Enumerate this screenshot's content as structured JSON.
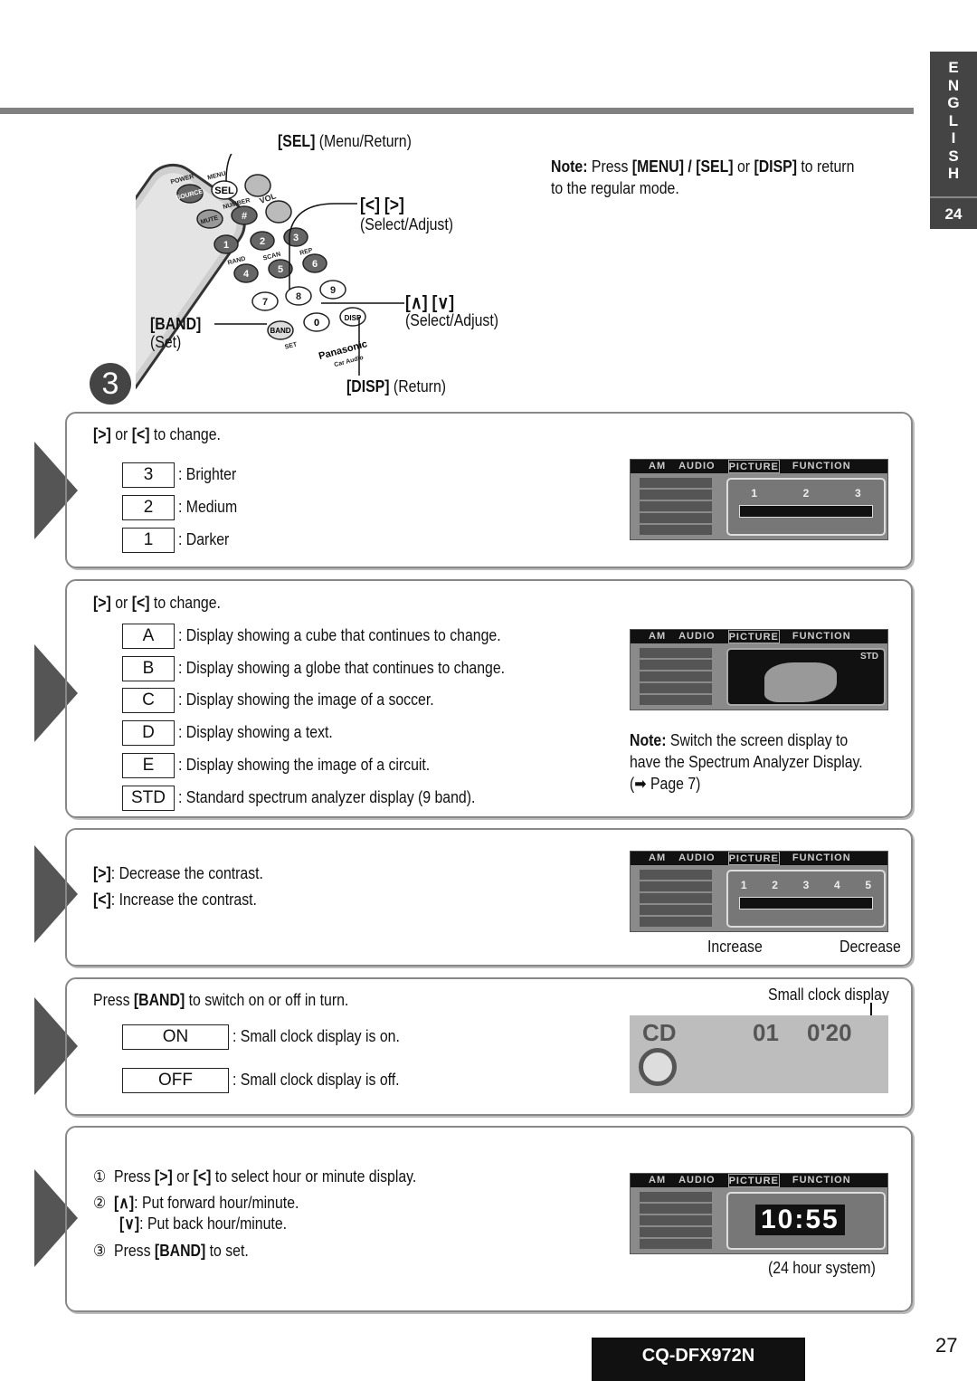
{
  "lang_tab": {
    "letters": "E N G L I S H",
    "page": "24"
  },
  "remote": {
    "sel": "[SEL]",
    "sel_desc": "(Menu/Return)",
    "lr": "[<] [>]",
    "lr_desc": "(Select/Adjust)",
    "ud": "[∧] [∨]",
    "ud_desc": "(Select/Adjust)",
    "band": "[BAND]",
    "band_desc": "(Set)",
    "disp": "[DISP]",
    "disp_desc": "(Return)",
    "brand": "Panasonic",
    "brand_sub": "Car Audio",
    "buttons": [
      "POWER",
      "SOURCE",
      "MENU",
      "SEL",
      "NUMBER",
      "VOL",
      "MUTE",
      "#",
      "1",
      "2",
      "3",
      "RAND",
      "SCAN",
      "REP",
      "4",
      "5",
      "6",
      "7",
      "8",
      "9",
      "0",
      "BAND",
      "SET",
      "DISP"
    ]
  },
  "step": "3",
  "note_top": {
    "label": "Note:",
    "pre": "Press",
    "k1": "[MENU] / [SEL]",
    "mid": "or",
    "k2": "[DISP]",
    "post": "to return",
    "line2": "to the regular mode."
  },
  "lcd_tabs": [
    "AM",
    "AUDIO",
    "PICTURE",
    "FUNCTION"
  ],
  "s1": {
    "key1": "[>]",
    "or": "or",
    "key2": "[<]",
    "post": "to change.",
    "options": [
      {
        "v": "3",
        "d": ": Brighter"
      },
      {
        "v": "2",
        "d": ": Medium"
      },
      {
        "v": "1",
        "d": ": Darker"
      }
    ],
    "lcd_nums": [
      "1",
      "2",
      "3"
    ]
  },
  "s2": {
    "key1": "[>]",
    "or": "or",
    "key2": "[<]",
    "post": "to change.",
    "options": [
      {
        "v": "A",
        "d": ": Display showing a cube that continues to change."
      },
      {
        "v": "B",
        "d": ": Display showing a globe that continues to change."
      },
      {
        "v": "C",
        "d": ": Display showing the image of a soccer."
      },
      {
        "v": "D",
        "d": ": Display showing a text."
      },
      {
        "v": "E",
        "d": ": Display showing the image of a circuit."
      },
      {
        "v": "STD",
        "d": ": Standard spectrum analyzer display (9 band)."
      }
    ],
    "note": {
      "label": "Note:",
      "l1": "Switch the screen display to",
      "l2": "have the Spectrum Analyzer Display.",
      "l3": "(➡ Page 7)"
    },
    "lcd_std": "STD"
  },
  "s3": {
    "k1": "[>]",
    "d1": ": Decrease the contrast.",
    "k2": "[<]",
    "d2": ": Increase the contrast.",
    "increase": "Increase",
    "decrease": "Decrease",
    "lcd_nums": [
      "1",
      "2",
      "3",
      "4",
      "5"
    ]
  },
  "s4": {
    "pre": "Press",
    "key": "[BAND]",
    "post": "to switch on or off in turn.",
    "options": [
      {
        "v": "ON",
        "d": ": Small clock display is on."
      },
      {
        "v": "OFF",
        "d": ": Small clock display is off."
      }
    ],
    "caption": "Small clock display",
    "lcd": {
      "src": "CD",
      "track": "01",
      "time": "0'20"
    }
  },
  "s5": {
    "n1": "①",
    "p1a": "Press",
    "k1": "[>]",
    "or": "or",
    "k2": "[<]",
    "p1b": "to select hour or minute display.",
    "n2": "②",
    "k3": "[∧]",
    "d3": ": Put forward hour/minute.",
    "k4": "[∨]",
    "d4": ": Put back hour/minute.",
    "n3": "③",
    "p3a": "Press",
    "k5": "[BAND]",
    "p3b": "to set.",
    "clock": "10:55",
    "caption": "(24 hour system)"
  },
  "footer": {
    "model": "CQ-DFX972N",
    "page": "27"
  }
}
